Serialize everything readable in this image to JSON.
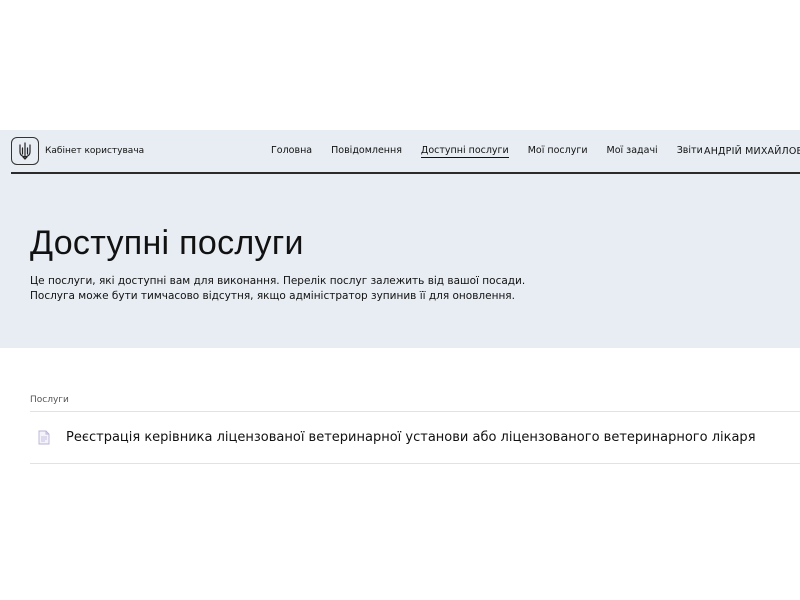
{
  "header": {
    "brand": "Кабінет користувача",
    "nav": [
      {
        "label": "Головна"
      },
      {
        "label": "Повідомлення"
      },
      {
        "label": "Доступні послуги",
        "active": true
      },
      {
        "label": "Мої послуги"
      },
      {
        "label": "Мої задачі"
      },
      {
        "label": "Звіти"
      }
    ],
    "user_name": "АНДРІЙ МИХАЙЛОВИЧ К"
  },
  "hero": {
    "title": "Доступні послуги",
    "line1": "Це послуги, які доступні вам для виконання. Перелік послуг залежить від вашої посади.",
    "line2": "Послуга може бути тимчасово відсутня, якщо адміністратор зупинив її для оновлення."
  },
  "services": {
    "section_label": "Послуги",
    "items": [
      {
        "title": "Реєстрація керівника ліцензованої ветеринарної установи або ліцензованого ветеринарного лікаря",
        "icon": "document-icon"
      }
    ]
  },
  "colors": {
    "header_bg": "#e7edf3",
    "text": "#111111",
    "divider": "#e2e2e2"
  }
}
